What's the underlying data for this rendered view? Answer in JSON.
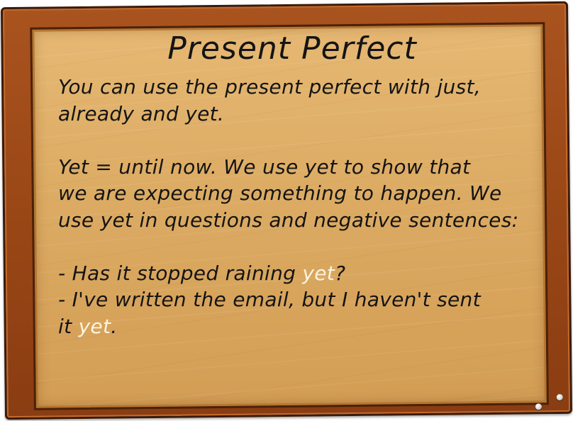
{
  "title": "Present Perfect",
  "intro": {
    "line1": "You can use the present perfect with just,",
    "line2": "already and yet."
  },
  "definition": {
    "line1": "Yet = until now. We use yet to show that",
    "line2": "we are expecting something to happen. We",
    "line3": "use yet in questions and negative sentences:"
  },
  "examples": [
    {
      "before": "- Has it stopped raining ",
      "highlight": "yet",
      "after": "?"
    },
    {
      "line1": "- I've written the email, but I haven't sent",
      "before": "it ",
      "highlight": "yet",
      "after": "."
    }
  ],
  "colors": {
    "frame": "#9a4716",
    "board": "#dcab63",
    "text": "#141414",
    "highlight": "#fbf3df"
  }
}
